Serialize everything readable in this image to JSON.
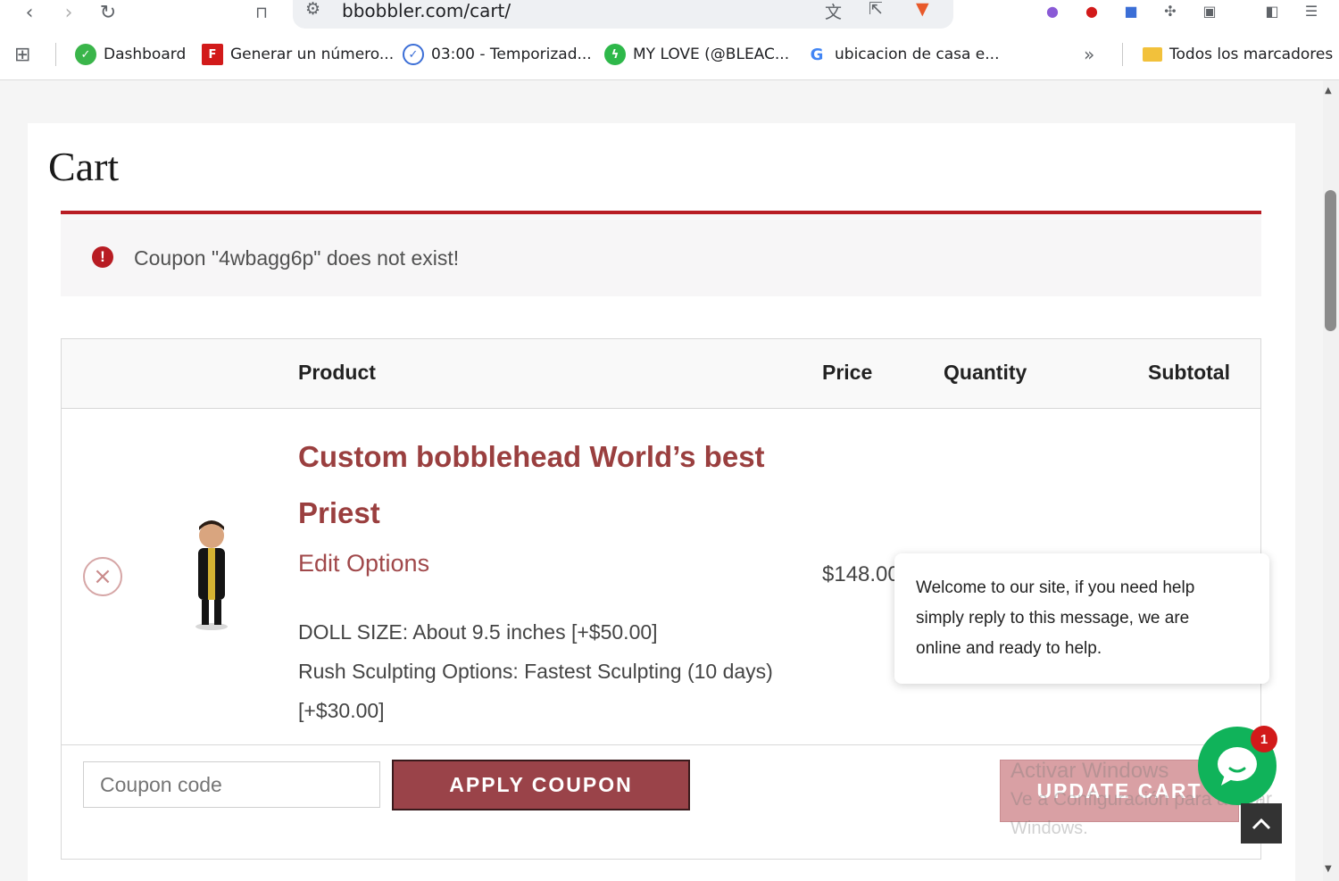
{
  "browser": {
    "url": "bbobbler.com/cart/",
    "bookmarks": [
      {
        "label": "Dashboard",
        "color": "#3ab54a"
      },
      {
        "label": "Generar un número...",
        "color": "#d21a1a"
      },
      {
        "label": "03:00 - Temporizad...",
        "color": "#3b6ed6"
      },
      {
        "label": "MY LOVE (@BLEAC...",
        "color": "#2eb84a"
      },
      {
        "label": "ubicacion de casa e...",
        "color": "#4285f4"
      }
    ],
    "all_bookmarks_label": "Todos los marcadores"
  },
  "page": {
    "title": "Cart",
    "error_message": "Coupon \"4wbagg6p\" does not exist!"
  },
  "table": {
    "headers": {
      "product": "Product",
      "price": "Price",
      "quantity": "Quantity",
      "subtotal": "Subtotal"
    },
    "item": {
      "name": "Custom bobblehead World’s best Priest",
      "edit_label": "Edit Options",
      "meta_line1": "DOLL SIZE: About 9.5 inches [+$50.00]",
      "meta_line2": "Rush Sculpting Options: Fastest Sculpting (10 days) [+$30.00]",
      "price": "$148.00"
    }
  },
  "actions": {
    "coupon_placeholder": "Coupon code",
    "apply_label": "APPLY COUPON",
    "update_label": "UPDATE CART"
  },
  "chat": {
    "message": "Welcome to our site, if you need help simply reply to this message, we are online and ready to help.",
    "badge_count": "1"
  },
  "watermark": {
    "line1": "Activar Windows",
    "line2": "Ve a Configuración para activar",
    "line3": "Windows."
  },
  "colors": {
    "accent": "#9a4349",
    "error_bar": "#b81c23",
    "chat_green": "#10b35a"
  }
}
